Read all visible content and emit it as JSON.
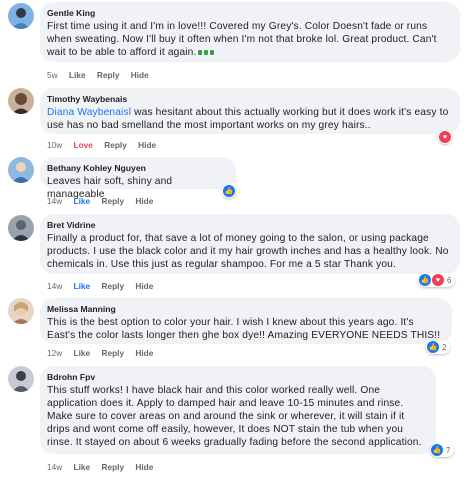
{
  "comments": [
    {
      "author": "Gentle King",
      "text": "First time using it and I'm in love!!! Covered my Grey's. Color Doesn't fade or runs when sweating. Now I'll buy it often when I'm not that broke lol. Great product. Can't wait to be able to afford it again.",
      "time": "5w",
      "like": "Like",
      "reply": "Reply",
      "hide": "Hide",
      "avatar_color": "#4a7fb5"
    },
    {
      "author": "Timothy Waybenais",
      "mention": "Diana Waybenaisl",
      "text": " was hesitant about this actually working but it does work it's easy to use has no bad smelland the most important works on my grey hairs..",
      "time": "10w",
      "love": "Love",
      "reply": "Reply",
      "hide": "Hide",
      "avatar_color": "#6b4a3a"
    },
    {
      "author": "Bethany Kohley Nguyen",
      "text": "Leaves hair soft, shiny and manageable",
      "time": "14w",
      "like": "Like",
      "reply": "Reply",
      "hide": "Hide",
      "avatar_color": "#3f6fa8"
    },
    {
      "author": "Bret Vidrine",
      "text": "Finally a product for, that save a lot of money going to the salon, or using package products. I use the black color and it my hair growth inches and has a healthy look. No chemicals in. Use this just as regular shampoo. For me a 5 star Thank you.",
      "time": "14w",
      "like": "Like",
      "reply": "Reply",
      "hide": "Hide",
      "reaction_count": "6",
      "avatar_color": "#5a6470"
    },
    {
      "author": "Melissa Manning",
      "text": "This is the best option to color your hair. I wish I knew about this years ago. It's East's the color lasts longer then ghe box dye!! Amazing EVERYONE NEEDS THIS!!",
      "time": "12w",
      "like": "Like",
      "reply": "Reply",
      "hide": "Hide",
      "reaction_count": "2",
      "avatar_color": "#c9a27a"
    },
    {
      "author": "Bdrohn Fpv",
      "text": "This stuff works! I have black hair and this color worked really well. One application does it. Apply to damped hair and leave 10-15 minutes and rinse. Make sure to cover areas on and around the sink or wherever, it will stain if it drips and wont come off easily, however, It does NOT stain the tub when you rinse. It stayed on about 6 weeks gradually fading before the second application.",
      "time": "14w",
      "like": "Like",
      "reply": "Reply",
      "hide": "Hide",
      "reaction_count": "7",
      "avatar_color": "#3b3f45"
    }
  ],
  "colors": {
    "bubble": "#f0f2f5",
    "link_blue": "#1877f2",
    "love_red": "#f33e58",
    "meta_gray": "#65676b"
  }
}
